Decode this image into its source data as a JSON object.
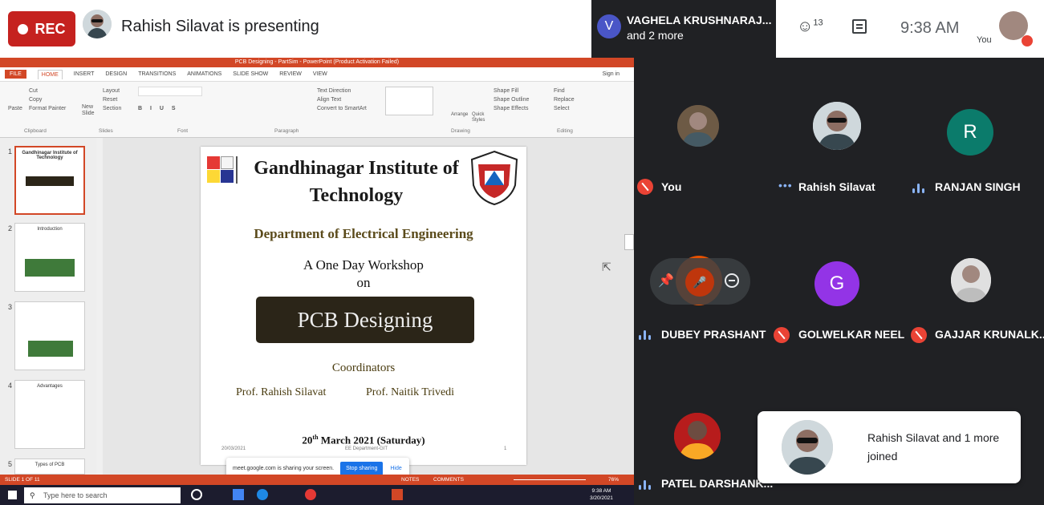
{
  "meet": {
    "rec_label": "REC",
    "presenting_text": "Rahish Silavat is presenting",
    "viewers_initial": "V",
    "viewers_line1": "VAGHELA KRUSHNARAJ...",
    "viewers_line2": "and 2 more",
    "participants_count": "13",
    "clock": "9:38 AM",
    "self_label": "You"
  },
  "participants": [
    {
      "name": "You",
      "status": "muted"
    },
    {
      "name": "Rahish Silavat",
      "status": "more"
    },
    {
      "name": "RANJAN SINGH",
      "initial": "R",
      "color": "#0b7b6b",
      "status": "speaking"
    },
    {
      "name": "DUBEY PRASHANT",
      "status": "speaking"
    },
    {
      "name": "GOLWELKAR NEEL",
      "initial": "G",
      "color": "#9334e6",
      "status": "muted"
    },
    {
      "name": "GAJJAR KRUNALK...",
      "status": "muted"
    },
    {
      "name": "PATEL DARSHANK...",
      "status": "speaking"
    }
  ],
  "toast": {
    "line1": "Rahish Silavat and 1 more",
    "line2": "joined"
  },
  "powerpoint": {
    "title": "PCB Designing - PartSim - PowerPoint (Product Activation Failed)",
    "tabs": [
      "FILE",
      "HOME",
      "INSERT",
      "DESIGN",
      "TRANSITIONS",
      "ANIMATIONS",
      "SLIDE SHOW",
      "REVIEW",
      "VIEW"
    ],
    "sign_in": "Sign in",
    "clipboard": {
      "cut": "Cut",
      "copy": "Copy",
      "paste": "Paste",
      "format_painter": "Format Painter",
      "label": "Clipboard"
    },
    "slides_group": {
      "new_slide": "New Slide",
      "layout": "Layout",
      "reset": "Reset",
      "section": "Section",
      "label": "Slides"
    },
    "font_label": "Font",
    "paragraph": {
      "text_direction": "Text Direction",
      "align_text": "Align Text",
      "smartart": "Convert to SmartArt",
      "label": "Paragraph"
    },
    "drawing": {
      "arrange": "Arrange",
      "quick_styles": "Quick Styles",
      "shape_fill": "Shape Fill",
      "shape_outline": "Shape Outline",
      "shape_effects": "Shape Effects",
      "label": "Drawing"
    },
    "editing": {
      "find": "Find",
      "replace": "Replace",
      "select": "Select",
      "label": "Editing"
    },
    "thumbs": [
      {
        "num": "1",
        "title": "Gandhinagar Institute of Technology"
      },
      {
        "num": "2",
        "title": "Introduction"
      },
      {
        "num": "3",
        "title": ""
      },
      {
        "num": "4",
        "title": "Advantages"
      },
      {
        "num": "5",
        "title": "Types of PCB"
      }
    ],
    "status_slide": "SLIDE 1 OF 11",
    "status_notes": "NOTES",
    "status_comments": "COMMENTS",
    "zoom": "76%"
  },
  "slide": {
    "title_line1": "Gandhinagar Institute of",
    "title_line2": "Technology",
    "department": "Department of Electrical Engineering",
    "workshop_line1": "A One Day Workshop",
    "workshop_line2": "on",
    "topic": "PCB Designing",
    "coordinators": "Coordinators",
    "prof1": "Prof. Rahish Silavat",
    "prof2": "Prof. Naitik Trivedi",
    "date_pre": "20",
    "date_sup": "th",
    "date_post": " March 2021 (Saturday)",
    "footer_date": "20/03/2021",
    "footer_center": "EE Department-GIT",
    "footer_num": "1",
    "logo_colors": [
      "#e53935",
      "#f5f5f5",
      "#fdd835",
      "#283593"
    ]
  },
  "share_bar": {
    "text": "meet.google.com is sharing your screen.",
    "stop": "Stop sharing",
    "hide": "Hide"
  },
  "taskbar": {
    "search": "Type here to search",
    "time": "9:38 AM",
    "date": "3/20/2021"
  }
}
